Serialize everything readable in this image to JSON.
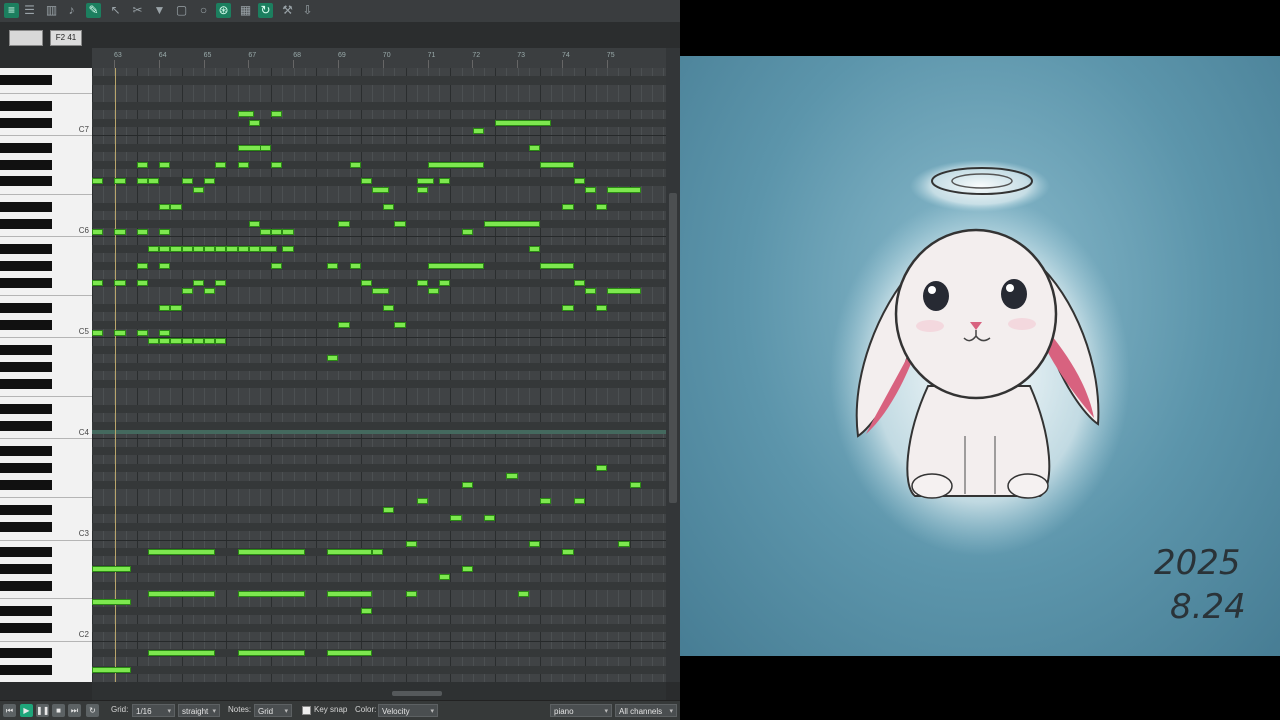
{
  "editor": {
    "pitch_box": "F2 41",
    "ruler_labels": [
      "63",
      "64",
      "65",
      "67",
      "68",
      "69",
      "70",
      "71",
      "72",
      "73",
      "74",
      "75"
    ],
    "octave_labels": [
      {
        "label": "C7",
        "pitch": 96
      },
      {
        "label": "C6",
        "pitch": 84
      },
      {
        "label": "C5",
        "pitch": 72
      },
      {
        "label": "C4",
        "pitch": 60
      },
      {
        "label": "C3",
        "pitch": 48
      },
      {
        "label": "C2",
        "pitch": 36
      }
    ],
    "notes": [
      [
        26,
        98,
        3
      ],
      [
        28,
        97,
        2
      ],
      [
        32,
        98,
        2
      ],
      [
        72,
        97,
        10
      ],
      [
        68,
        96,
        2
      ],
      [
        26,
        94,
        6
      ],
      [
        30,
        94,
        2
      ],
      [
        78,
        94,
        2
      ],
      [
        8,
        92,
        2
      ],
      [
        12,
        92,
        2
      ],
      [
        22,
        92,
        2
      ],
      [
        26,
        92,
        2
      ],
      [
        32,
        92,
        2
      ],
      [
        46,
        92,
        2
      ],
      [
        60,
        92,
        10
      ],
      [
        80,
        92,
        6
      ],
      [
        0,
        90,
        2
      ],
      [
        4,
        90,
        2
      ],
      [
        8,
        90,
        2
      ],
      [
        10,
        90,
        2
      ],
      [
        16,
        90,
        2
      ],
      [
        20,
        90,
        2
      ],
      [
        48,
        90,
        2
      ],
      [
        58,
        90,
        3
      ],
      [
        62,
        90,
        2
      ],
      [
        86,
        90,
        2
      ],
      [
        18,
        89,
        2
      ],
      [
        50,
        89,
        3
      ],
      [
        58,
        89,
        2
      ],
      [
        88,
        89,
        2
      ],
      [
        92,
        89,
        6
      ],
      [
        12,
        87,
        2
      ],
      [
        14,
        87,
        2
      ],
      [
        52,
        87,
        2
      ],
      [
        84,
        87,
        2
      ],
      [
        90,
        87,
        2
      ],
      [
        28,
        85,
        2
      ],
      [
        44,
        85,
        2
      ],
      [
        54,
        85,
        2
      ],
      [
        70,
        85,
        10
      ],
      [
        66,
        84,
        2
      ],
      [
        32,
        84,
        2
      ],
      [
        0,
        84,
        2
      ],
      [
        4,
        84,
        2
      ],
      [
        8,
        84,
        2
      ],
      [
        12,
        84,
        2
      ],
      [
        30,
        84,
        2
      ],
      [
        34,
        84,
        2
      ],
      [
        10,
        82,
        2
      ],
      [
        12,
        82,
        2
      ],
      [
        14,
        82,
        2
      ],
      [
        16,
        82,
        2
      ],
      [
        18,
        82,
        2
      ],
      [
        20,
        82,
        2
      ],
      [
        22,
        82,
        2
      ],
      [
        24,
        82,
        2
      ],
      [
        26,
        82,
        2
      ],
      [
        28,
        82,
        2
      ],
      [
        30,
        82,
        3
      ],
      [
        78,
        82,
        2
      ],
      [
        34,
        82,
        2
      ],
      [
        8,
        80,
        2
      ],
      [
        12,
        80,
        2
      ],
      [
        32,
        80,
        2
      ],
      [
        42,
        80,
        2
      ],
      [
        46,
        80,
        2
      ],
      [
        60,
        80,
        10
      ],
      [
        80,
        80,
        6
      ],
      [
        0,
        78,
        2
      ],
      [
        4,
        78,
        2
      ],
      [
        8,
        78,
        2
      ],
      [
        18,
        78,
        2
      ],
      [
        22,
        78,
        2
      ],
      [
        48,
        78,
        2
      ],
      [
        58,
        78,
        2
      ],
      [
        62,
        78,
        2
      ],
      [
        86,
        78,
        2
      ],
      [
        16,
        77,
        2
      ],
      [
        20,
        77,
        2
      ],
      [
        50,
        77,
        3
      ],
      [
        60,
        77,
        2
      ],
      [
        88,
        77,
        2
      ],
      [
        92,
        77,
        6
      ],
      [
        12,
        75,
        2
      ],
      [
        14,
        75,
        2
      ],
      [
        52,
        75,
        2
      ],
      [
        84,
        75,
        2
      ],
      [
        90,
        75,
        2
      ],
      [
        44,
        73,
        2
      ],
      [
        54,
        73,
        2
      ],
      [
        0,
        72,
        2
      ],
      [
        4,
        72,
        2
      ],
      [
        8,
        72,
        2
      ],
      [
        12,
        72,
        2
      ],
      [
        10,
        71,
        2
      ],
      [
        12,
        71,
        2
      ],
      [
        14,
        71,
        2
      ],
      [
        16,
        71,
        2
      ],
      [
        18,
        71,
        2
      ],
      [
        20,
        71,
        2
      ],
      [
        22,
        71,
        2
      ],
      [
        42,
        69,
        2
      ],
      [
        90,
        56,
        2
      ],
      [
        74,
        55,
        2
      ],
      [
        66,
        54,
        2
      ],
      [
        96,
        54,
        2
      ],
      [
        58,
        52,
        2
      ],
      [
        80,
        52,
        2
      ],
      [
        86,
        52,
        2
      ],
      [
        52,
        51,
        2
      ],
      [
        70,
        50,
        2
      ],
      [
        64,
        50,
        2
      ],
      [
        56,
        47,
        2
      ],
      [
        78,
        47,
        2
      ],
      [
        94,
        47,
        2
      ],
      [
        10,
        46,
        12
      ],
      [
        26,
        46,
        12
      ],
      [
        42,
        46,
        8
      ],
      [
        50,
        46,
        2
      ],
      [
        84,
        46,
        2
      ],
      [
        0,
        44,
        7
      ],
      [
        66,
        44,
        2
      ],
      [
        62,
        43,
        2
      ],
      [
        10,
        41,
        12
      ],
      [
        26,
        41,
        12
      ],
      [
        42,
        41,
        8
      ],
      [
        56,
        41,
        2
      ],
      [
        76,
        41,
        2
      ],
      [
        0,
        40,
        7
      ],
      [
        48,
        39,
        2
      ],
      [
        10,
        34,
        12
      ],
      [
        26,
        34,
        12
      ],
      [
        42,
        34,
        8
      ],
      [
        0,
        32,
        7
      ]
    ]
  },
  "bottom_bar": {
    "grid_label": "Grid:",
    "grid_value": "1/16",
    "swing_value": "straight",
    "notes_label": "Notes:",
    "notes_value": "Grid",
    "keysnap_label": "Key snap",
    "color_label": "Color:",
    "color_value": "Velocity",
    "instrument_value": "piano",
    "channels_value": "All channels"
  },
  "artwork": {
    "date_line1": "2025",
    "date_line2": "8.24",
    "colors": {
      "background": "#5c95ab",
      "ear_inner": "#d8627f",
      "fur": "#f3eeee"
    }
  }
}
